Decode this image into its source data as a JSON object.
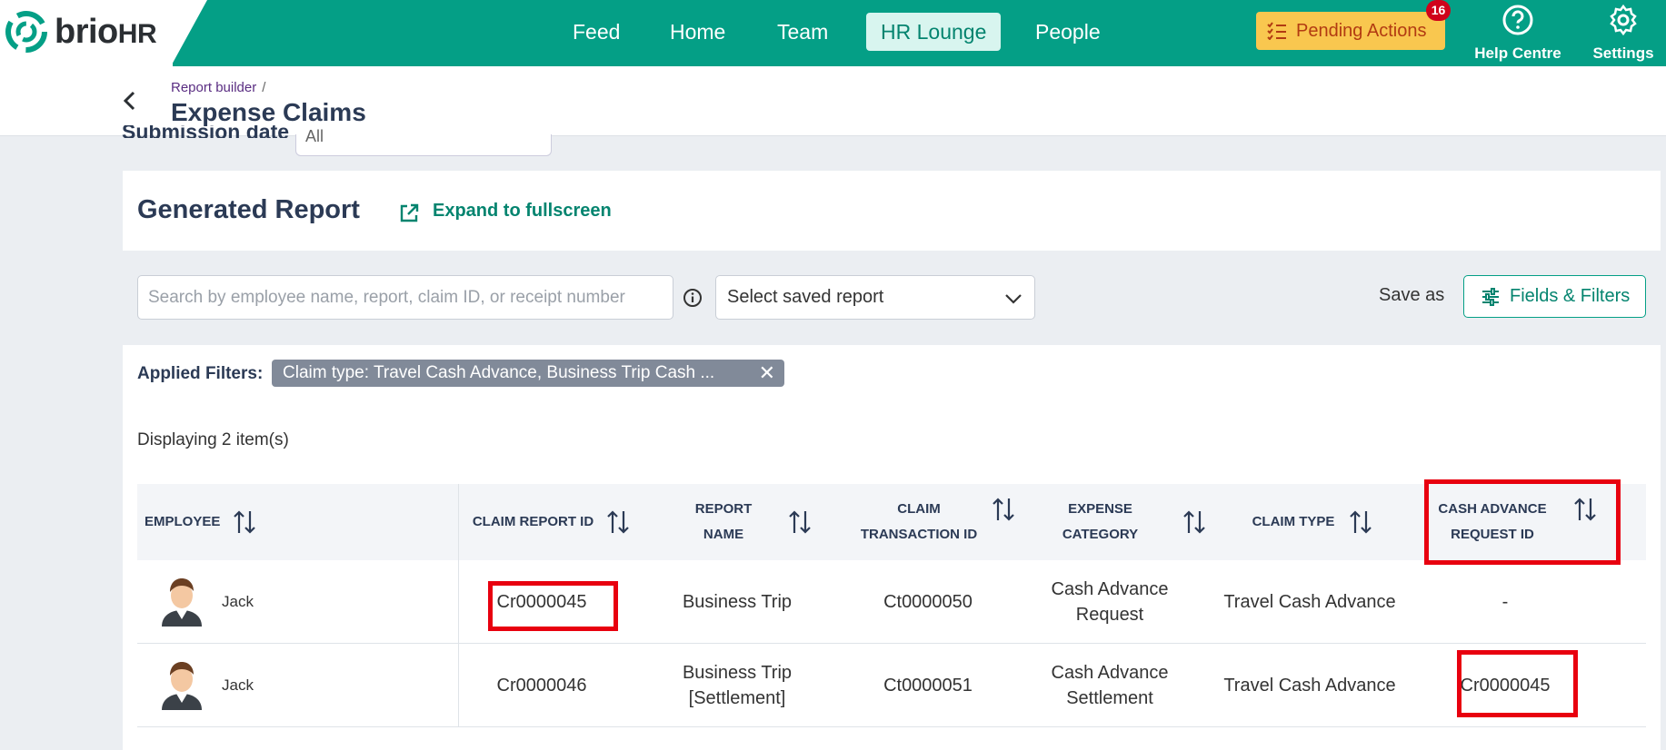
{
  "app": {
    "logo_brio": "brio",
    "logo_hr": "HR",
    "colors": {
      "brand": "#049f86",
      "pending": "#f9c74f",
      "badge": "#d0021b",
      "highlight": "#e8000f"
    }
  },
  "nav": {
    "items": [
      {
        "label": "Feed"
      },
      {
        "label": "Home"
      },
      {
        "label": "Team"
      },
      {
        "label": "HR Lounge"
      },
      {
        "label": "People"
      }
    ],
    "pending_label": "Pending Actions",
    "pending_count": "16",
    "help_label": "Help Centre",
    "settings_label": "Settings"
  },
  "header": {
    "breadcrumb": "Report builder",
    "breadcrumb_sep": "/",
    "title": "Expense Claims"
  },
  "filters": {
    "submission_label": "Submission date",
    "submission_value": "All"
  },
  "report": {
    "title": "Generated Report",
    "expand_label": "Expand to fullscreen",
    "search_placeholder": "Search by employee name, report, claim ID, or receipt number",
    "select_placeholder": "Select saved report",
    "save_as": "Save as",
    "fields_filters": "Fields & Filters",
    "applied_label": "Applied Filters:",
    "applied_chip": "Claim type: Travel Cash Advance, Business Trip Cash ...",
    "chip_close": "✕",
    "displaying": "Displaying 2 item(s)"
  },
  "table": {
    "headers": {
      "employee": "EMPLOYEE",
      "claim_report_id": "CLAIM REPORT ID",
      "report_name": "REPORT NAME",
      "claim_txn_1": "CLAIM",
      "claim_txn_2": "TRANSACTION ID",
      "expense_category": "EXPENSE CATEGORY",
      "claim_type": "CLAIM TYPE",
      "cash_adv_1": "CASH ADVANCE",
      "cash_adv_2": "REQUEST ID"
    },
    "rows": [
      {
        "employee": "Jack",
        "claim_report_id": "Cr0000045",
        "report_name_1": "Business Trip",
        "report_name_2": "",
        "claim_txn_id": "Ct0000050",
        "category_1": "Cash Advance",
        "category_2": "Request",
        "claim_type": "Travel Cash Advance",
        "cash_adv_id": "-"
      },
      {
        "employee": "Jack",
        "claim_report_id": "Cr0000046",
        "report_name_1": "Business Trip",
        "report_name_2": "[Settlement]",
        "claim_txn_id": "Ct0000051",
        "category_1": "Cash Advance",
        "category_2": "Settlement",
        "claim_type": "Travel Cash Advance",
        "cash_adv_id": "Cr0000045"
      }
    ]
  }
}
